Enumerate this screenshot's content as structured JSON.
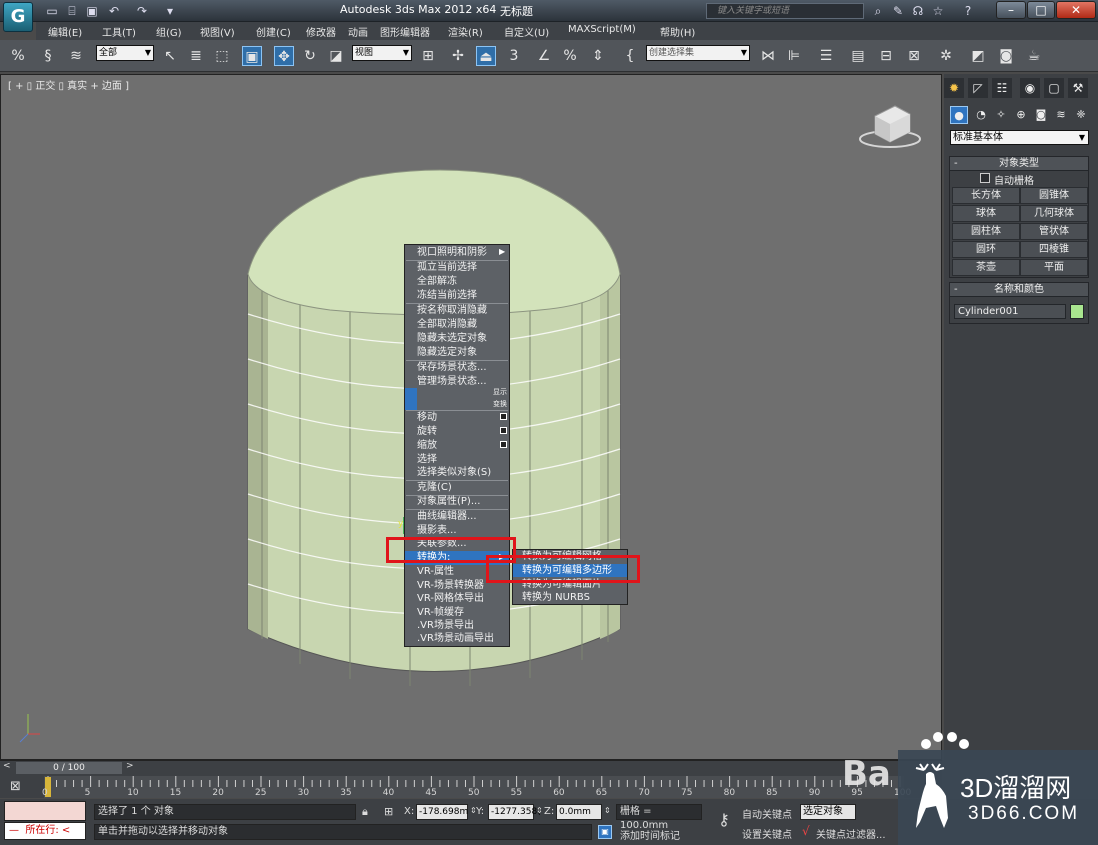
{
  "titlebar": {
    "title": "Autodesk 3ds Max  2012 x64",
    "document": "无标题",
    "search_placeholder": "键入关键字或短语",
    "logo_letter": "G"
  },
  "menubar": {
    "items": [
      "编辑(E)",
      "工具(T)",
      "组(G)",
      "视图(V)",
      "创建(C)",
      "修改器",
      "动画",
      "图形编辑器",
      "渲染(R)",
      "自定义(U)",
      "MAXScript(M)",
      "帮助(H)"
    ]
  },
  "toolbar": {
    "selection_filter": "全部",
    "reference_coord": "视图",
    "named_selection": "创建选择集",
    "snap_labels": [
      "3",
      "%"
    ]
  },
  "viewport": {
    "label": "[ + ] [ 正交 ] [ 真实 + 边面 ]",
    "label_display": "[ + ▯ 正交 ▯ 真实 + 边面 ]"
  },
  "context_menu": {
    "items": [
      "视口照明和阴影",
      "孤立当前选择",
      "全部解冻",
      "冻结当前选择",
      "按名称取消隐藏",
      "全部取消隐藏",
      "隐藏未选定对象",
      "隐藏选定对象",
      "保存场景状态...",
      "管理场景状态...",
      "显示",
      "变换",
      "移动",
      "旋转",
      "缩放",
      "选择",
      "选择类似对象(S)",
      "克隆(C)",
      "对象属性(P)...",
      "曲线编辑器...",
      "摄影表...",
      "关联参数...",
      "转换为:",
      "VR-属性",
      "VR-场景转换器",
      "VR-网格体导出",
      "VR-帧缓存",
      ".VR场景导出",
      ".VR场景动画导出"
    ],
    "highlighted": "转换为:"
  },
  "submenu": {
    "items": [
      "转换为可编辑网格",
      "转换为可编辑多边形",
      "转换为可编辑面片",
      "转换为 NURBS"
    ],
    "highlighted": "转换为可编辑多边形"
  },
  "command_panel": {
    "category": "标准基本体",
    "object_type_title": "对象类型",
    "autogrid_label": "自动栅格",
    "object_buttons": [
      "长方体",
      "圆锥体",
      "球体",
      "几何球体",
      "圆柱体",
      "管状体",
      "圆环",
      "四棱锥",
      "茶壶",
      "平面"
    ],
    "name_color_title": "名称和颜色",
    "object_name": "Cylinder001",
    "object_color": "#a9e58f"
  },
  "timeline": {
    "frame_indicator": "0 / 100",
    "ticks": [
      "0",
      "5",
      "10",
      "15",
      "20",
      "25",
      "30",
      "35",
      "40",
      "45",
      "50",
      "55",
      "60",
      "65",
      "70",
      "75",
      "80",
      "85",
      "90",
      "95",
      "100"
    ]
  },
  "status": {
    "selected_text": "选择了 1 个 对象",
    "prompt_text": "单击并拖动以选择并移动对象",
    "script_listener": "所在行:",
    "x_label": "X:",
    "x_value": "-178.698m",
    "y_label": "Y:",
    "y_value": "-1277.358(",
    "z_label": "Z:",
    "z_value": "0.0mm",
    "grid": "栅格 = 100.0mm",
    "auto_key": "自动关键点",
    "selected_set": "选定对象",
    "set_key": "设置关键点",
    "key_filters": "关键点过滤器...",
    "add_time_tag": "添加时间标记"
  },
  "watermark": {
    "bai_text": "Ba",
    "brand": "3D溜溜网",
    "domain": "3D66.COM"
  },
  "colors": {
    "cylinder": "#cfe0b6",
    "highlight": "#2f74c0",
    "annotation_red": "#e0141a"
  }
}
